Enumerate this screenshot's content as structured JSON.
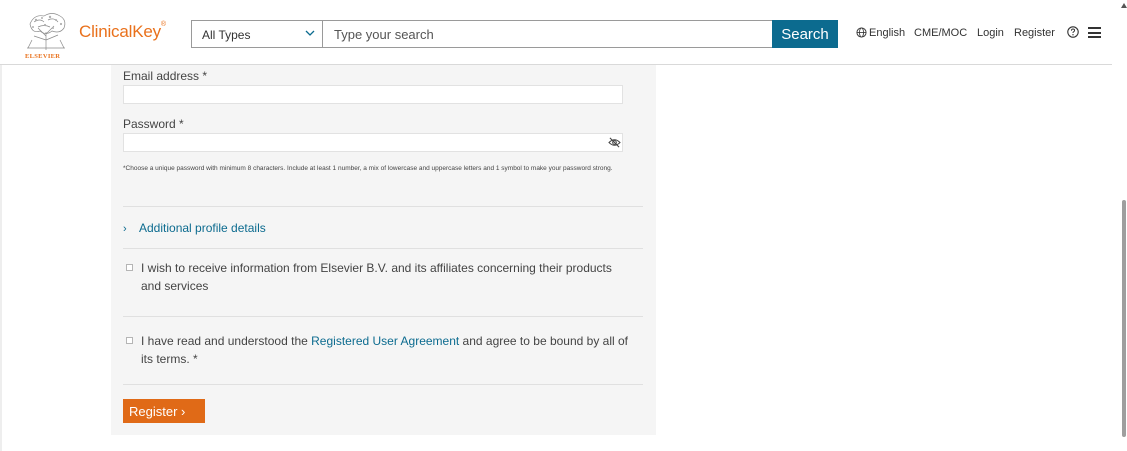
{
  "header": {
    "logo_text": "ELSEVIER",
    "brand": "ClinicalKey",
    "brand_mark": "®",
    "search": {
      "type_selected": "All Types",
      "placeholder": "Type your search",
      "button_label": "Search"
    },
    "nav": {
      "language": "English",
      "cme": "CME/MOC",
      "login": "Login",
      "register": "Register"
    },
    "icons": [
      "globe-icon",
      "help-icon",
      "menu-icon",
      "chevron-down-icon"
    ]
  },
  "form": {
    "email_label": "Email address *",
    "email_value": "",
    "password_label": "Password *",
    "password_value": "",
    "password_hint": "*Choose a unique password with minimum 8 characters. Include at least 1 number, a mix of lowercase and uppercase letters and 1 symbol to make your password strong.",
    "additional_details": "Additional profile details",
    "marketing_consent": "I wish to receive information from Elsevier B.V. and its affiliates concerning their products and services",
    "agreement_before": "I have read and understood the ",
    "agreement_link": "Registered User Agreement",
    "agreement_after": " and agree to be bound by all of its terms. *",
    "submit_label": "Register",
    "submit_chevron": "›"
  },
  "colors": {
    "brand_orange": "#e9711c",
    "button_orange": "#e06a17",
    "accent_blue": "#0c6b8f",
    "panel_bg": "#f5f5f5"
  }
}
